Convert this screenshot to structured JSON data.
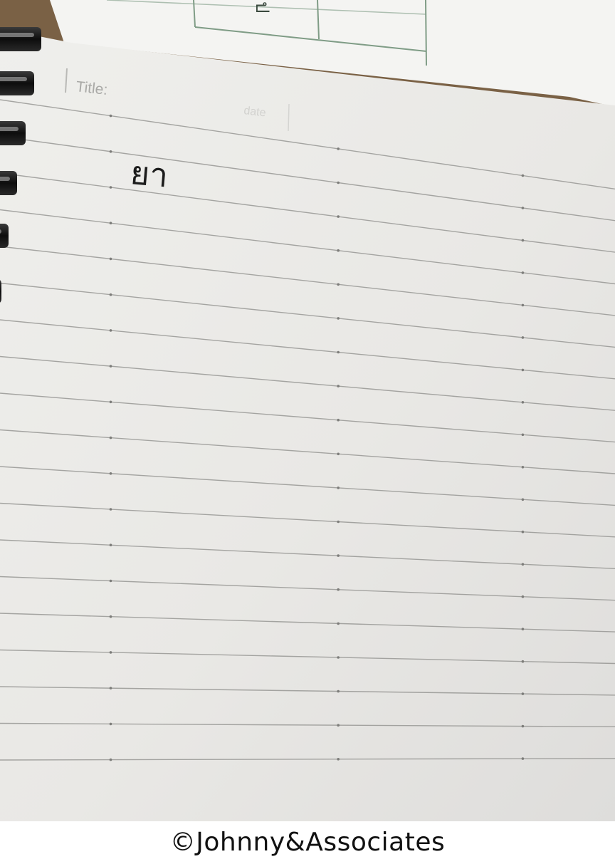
{
  "photo": {
    "notebook": {
      "title_label": "Title:",
      "date_label": "date",
      "handwritten_text": "ยา"
    }
  },
  "caption": {
    "text": "©Johnny&Associates"
  },
  "colors": {
    "paper": "#ecebe8",
    "back_paper": "#f4f4f2",
    "table_green": "#7f9c86",
    "rule_line": "#8d8d8a",
    "wood": "#7a6145",
    "spiral_ring": "#1a1a1a",
    "ink": "#1c1c1c"
  }
}
